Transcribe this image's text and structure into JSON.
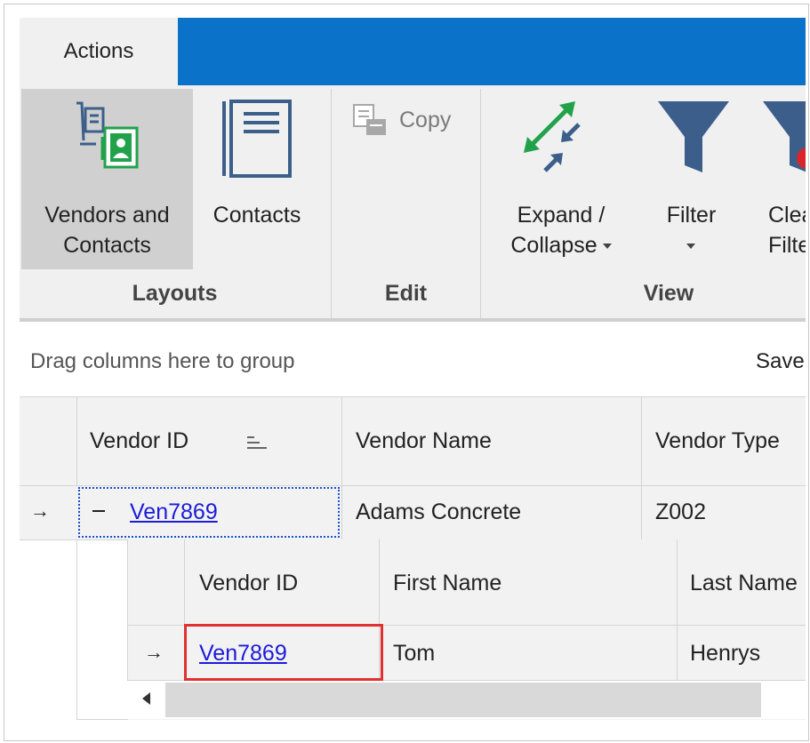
{
  "ribbon": {
    "tab_label": "Actions",
    "buttons": {
      "vendors_contacts_line1": "Vendors and",
      "vendors_contacts_line2": "Contacts",
      "contacts": "Contacts",
      "copy": "Copy",
      "expand_line1": "Expand /",
      "expand_line2": "Collapse",
      "filter": "Filter",
      "clear_line1": "Clea",
      "clear_line2": "Filte"
    },
    "groups": {
      "layouts": "Layouts",
      "edit": "Edit",
      "view": "View"
    },
    "accent_color": "#0a73c9"
  },
  "grid": {
    "group_hint": "Drag columns here to group",
    "save_label": "Save",
    "columns": [
      "Vendor ID",
      "Vendor Name",
      "Vendor Type"
    ],
    "row": {
      "vendor_id": "Ven7869",
      "vendor_name": "Adams Concrete",
      "vendor_type": "Z002"
    },
    "detail": {
      "columns": [
        "Vendor ID",
        "First Name",
        "Last Name"
      ],
      "row": {
        "vendor_id": "Ven7869",
        "first_name": "Tom",
        "last_name": "Henrys"
      }
    }
  }
}
